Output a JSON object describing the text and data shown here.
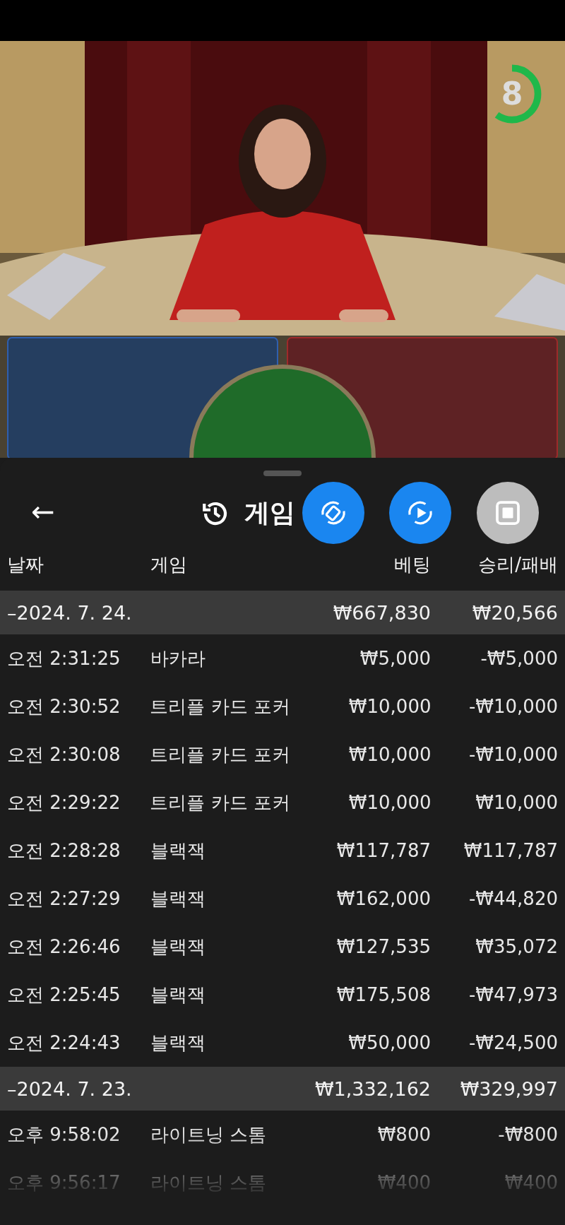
{
  "video": {
    "kind": "picture",
    "timer": {
      "value": "8",
      "level": 0.6
    }
  },
  "panel": {
    "title": "게임",
    "back": "←",
    "columns": [
      "날짜",
      "게임",
      "베팅",
      "승리/패배"
    ],
    "groups": [
      {
        "date": "–2024. 7. 24.",
        "bet": "₩667,830",
        "result": "₩20,566",
        "rows": [
          {
            "time": "오전 2:31:25",
            "game": "바카라",
            "bet": "₩5,000",
            "result": "-₩5,000"
          },
          {
            "time": "오전 2:30:52",
            "game": "트리플 카드 포커",
            "bet": "₩10,000",
            "result": "-₩10,000"
          },
          {
            "time": "오전 2:30:08",
            "game": "트리플 카드 포커",
            "bet": "₩10,000",
            "result": "-₩10,000"
          },
          {
            "time": "오전 2:29:22",
            "game": "트리플 카드 포커",
            "bet": "₩10,000",
            "result": "₩10,000"
          },
          {
            "time": "오전 2:28:28",
            "game": "블랙잭",
            "bet": "₩117,787",
            "result": "₩117,787"
          },
          {
            "time": "오전 2:27:29",
            "game": "블랙잭",
            "bet": "₩162,000",
            "result": "-₩44,820"
          },
          {
            "time": "오전 2:26:46",
            "game": "블랙잭",
            "bet": "₩127,535",
            "result": "₩35,072"
          },
          {
            "time": "오전 2:25:45",
            "game": "블랙잭",
            "bet": "₩175,508",
            "result": "-₩47,973"
          },
          {
            "time": "오전 2:24:43",
            "game": "블랙잭",
            "bet": "₩50,000",
            "result": "-₩24,500"
          }
        ]
      },
      {
        "date": "–2024. 7. 23.",
        "bet": "₩1,332,162",
        "result": "₩329,997",
        "rows": [
          {
            "time": "오후 9:58:02",
            "game": "라이트닝 스톰",
            "bet": "₩800",
            "result": "-₩800"
          },
          {
            "time": "오후 9:56:17",
            "game": "라이트닝 스톰",
            "bet": "₩400",
            "result": "₩400"
          }
        ]
      }
    ]
  }
}
